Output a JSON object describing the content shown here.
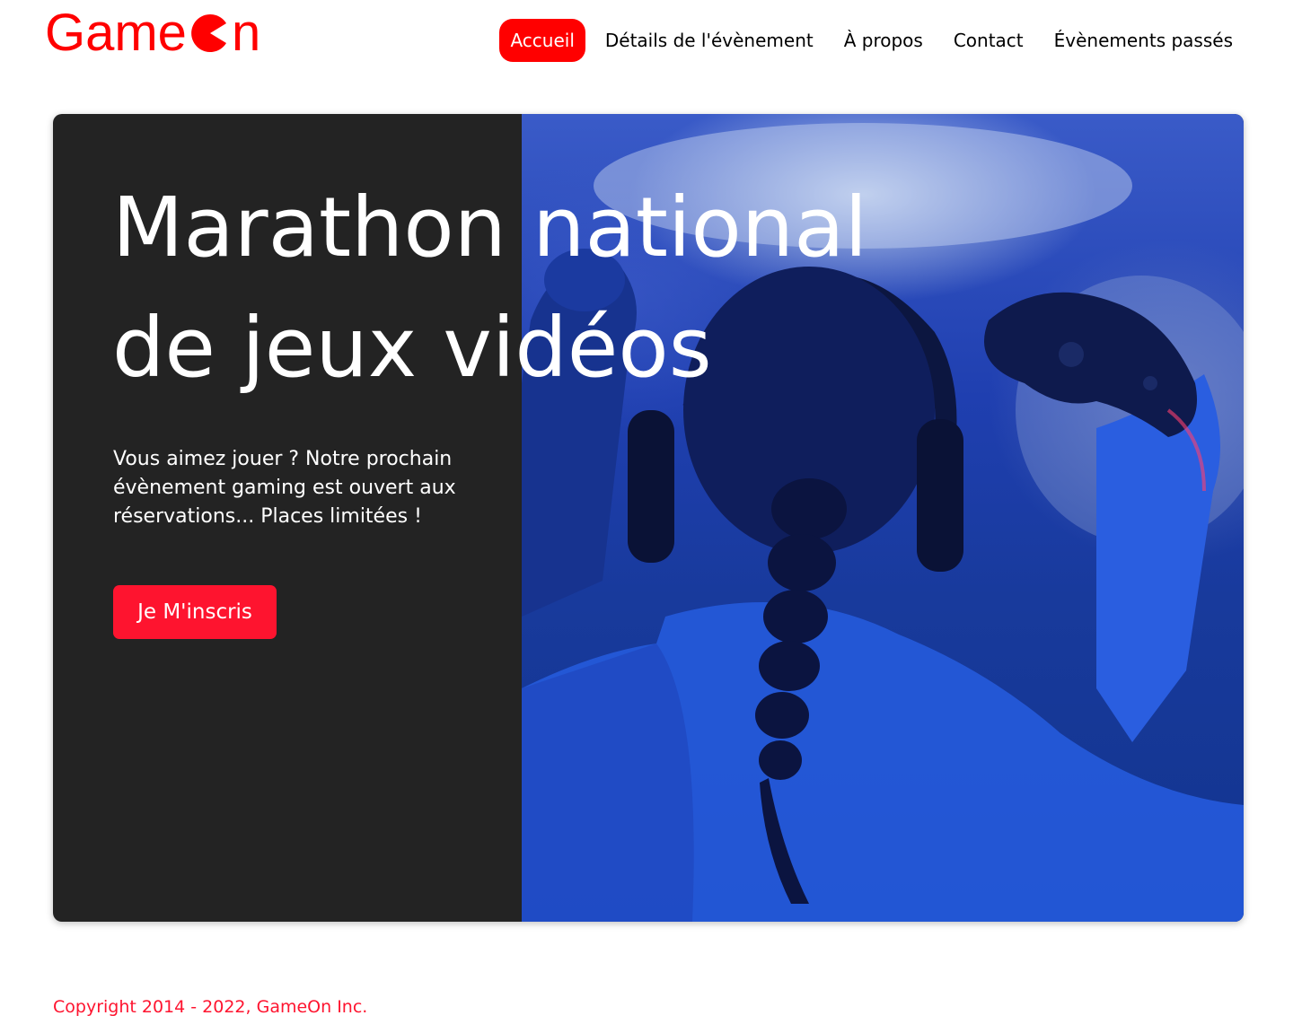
{
  "brand": {
    "name_prefix": "Game",
    "name_suffix": "n",
    "logo_icon": "pacman-o-icon",
    "color": "#ff0000"
  },
  "nav": {
    "items": [
      {
        "label": "Accueil",
        "active": true
      },
      {
        "label": "Détails de l'évènement",
        "active": false
      },
      {
        "label": "À propos",
        "active": false
      },
      {
        "label": "Contact",
        "active": false
      },
      {
        "label": "Évènements passés",
        "active": false
      }
    ]
  },
  "hero": {
    "title": "Marathon national de jeux vidéos",
    "description": "Vous aimez jouer ? Notre prochain évènement gaming est ouvert aux réservations... Places limitées !",
    "cta_label": "Je M'inscris",
    "image_subject": "gamer-with-headphones-and-controller-image"
  },
  "footer": {
    "copyright": "Copyright 2014 - 2022, GameOn Inc."
  },
  "colors": {
    "accent": "#fe142f",
    "nav_active": "#ff0000",
    "hero_bg": "#232323"
  }
}
